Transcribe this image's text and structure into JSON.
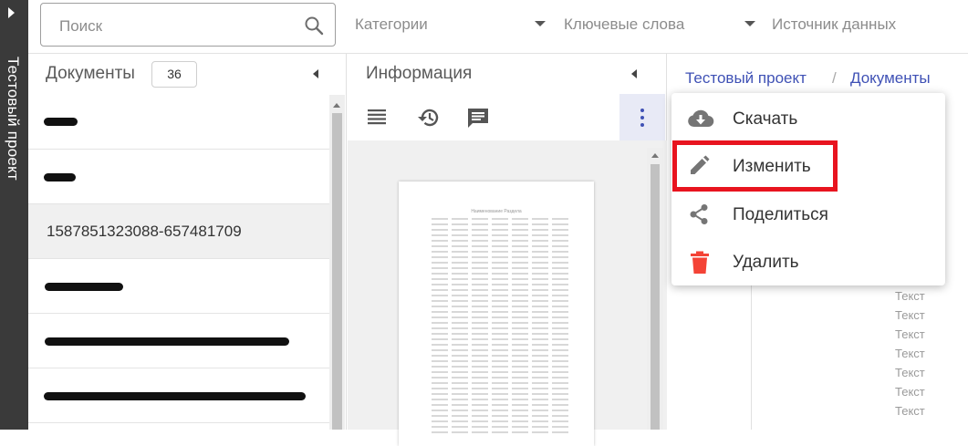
{
  "sidebar_strip": {
    "label": "Тестовый проект"
  },
  "filters": {
    "search_placeholder": "Поиск",
    "categories": "Категории",
    "keywords": "Ключевые слова",
    "data_source": "Источник данных"
  },
  "documents": {
    "title": "Документы",
    "count": "36",
    "items": [
      {
        "label": "",
        "redacted": true
      },
      {
        "label": "",
        "redacted": true
      },
      {
        "label": "1587851323088-657481709",
        "redacted": false,
        "selected": true
      },
      {
        "label": "",
        "redacted": true
      },
      {
        "label": "",
        "redacted": true
      },
      {
        "label": "",
        "redacted": true
      }
    ]
  },
  "info": {
    "title": "Информация",
    "tools": [
      "list-icon",
      "history-icon",
      "comment-icon",
      "more-vert-icon"
    ],
    "preview_heading": "Наименование Раздела"
  },
  "breadcrumb": {
    "project": "Тестовый проект",
    "separator": "/",
    "section": "Документы"
  },
  "menu": {
    "items": [
      {
        "label": "Скачать",
        "icon": "cloud-download-icon",
        "color": "#757575"
      },
      {
        "label": "Изменить",
        "icon": "edit-icon",
        "color": "#757575",
        "highlighted": true
      },
      {
        "label": "Поделиться",
        "icon": "share-icon",
        "color": "#757575"
      },
      {
        "label": "Удалить",
        "icon": "delete-icon",
        "color": "#f44336"
      }
    ]
  },
  "background_text": {
    "items": [
      "Текст",
      "Текст",
      "Текст",
      "Текст",
      "Текст",
      "Текст",
      "Текст"
    ]
  },
  "colors": {
    "accent": "#3f51b5",
    "highlight": "#e8141f",
    "delete": "#f44336"
  }
}
